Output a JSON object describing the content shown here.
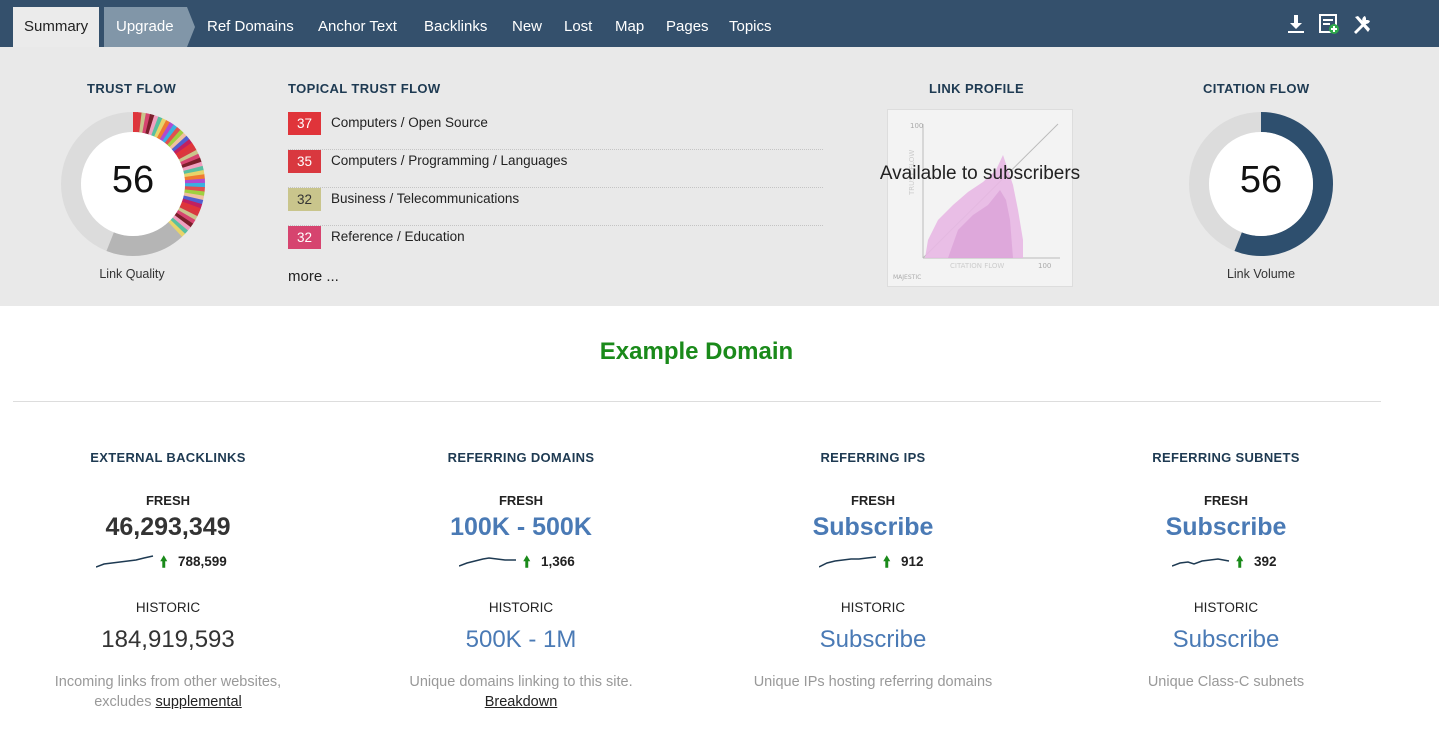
{
  "nav": {
    "tabs": [
      {
        "label": "Summary"
      },
      {
        "label": "Upgrade"
      },
      {
        "label": "Ref Domains"
      },
      {
        "label": "Anchor Text"
      },
      {
        "label": "Backlinks"
      },
      {
        "label": "New"
      },
      {
        "label": "Lost"
      },
      {
        "label": "Map"
      },
      {
        "label": "Pages"
      },
      {
        "label": "Topics"
      }
    ],
    "icons": [
      "download-icon",
      "report-icon",
      "tools-icon"
    ]
  },
  "trust_flow": {
    "title": "TRUST FLOW",
    "value": "56",
    "caption": "Link Quality",
    "level": 0.56
  },
  "topical_trust_flow": {
    "title": "TOPICAL TRUST FLOW",
    "items": [
      {
        "score": "37",
        "label": "Computers / Open Source",
        "color": "#e0343a"
      },
      {
        "score": "35",
        "label": "Computers / Programming / Languages",
        "color": "#d9383f"
      },
      {
        "score": "32",
        "label": "Business / Telecommunications",
        "color": "#c9c58c"
      },
      {
        "score": "32",
        "label": "Reference / Education",
        "color": "#d6446f"
      }
    ],
    "more_label": "more ..."
  },
  "link_profile": {
    "title": "LINK PROFILE",
    "overlay": "Available to subscribers",
    "axis_y": "TRUST FLOW",
    "axis_x": "CITATION FLOW",
    "tick_max": "100",
    "brand": "MAJESTIC"
  },
  "citation_flow": {
    "title": "CITATION FLOW",
    "value": "56",
    "caption": "Link Volume",
    "level": 0.56
  },
  "domain": {
    "title": "Example Domain"
  },
  "stats": [
    {
      "title": "EXTERNAL BACKLINKS",
      "fresh_label": "FRESH",
      "fresh_value": "46,293,349",
      "delta": "788,599",
      "hist_label": "HISTORIC",
      "hist_value": "184,919,593",
      "desc": "Incoming links from other websites,",
      "desc2": "excludes",
      "desc_link": "supplemental"
    },
    {
      "title": "REFERRING DOMAINS",
      "fresh_label": "FRESH",
      "fresh_value": "100K - 500K",
      "delta": "1,366",
      "hist_label": "HISTORIC",
      "hist_value": "500K - 1M",
      "desc": "Unique domains linking to this site.",
      "desc_link": "Breakdown"
    },
    {
      "title": "REFERRING IPS",
      "fresh_label": "FRESH",
      "fresh_value": "Subscribe",
      "delta": "912",
      "hist_label": "HISTORIC",
      "hist_value": "Subscribe",
      "desc": "Unique IPs hosting referring domains"
    },
    {
      "title": "REFERRING SUBNETS",
      "fresh_label": "FRESH",
      "fresh_value": "Subscribe",
      "delta": "392",
      "hist_label": "HISTORIC",
      "hist_value": "Subscribe",
      "desc": "Unique Class-C subnets"
    }
  ],
  "colors": {
    "nav_bg": "#34506c",
    "upgrade_bg": "#8196a8",
    "panel_bg": "#e9e9e9",
    "title_dark": "#1e3a52",
    "domain_green": "#1a8a1a",
    "link_blue": "#4a7ab5",
    "citation_ring": "#2e4f6e"
  }
}
